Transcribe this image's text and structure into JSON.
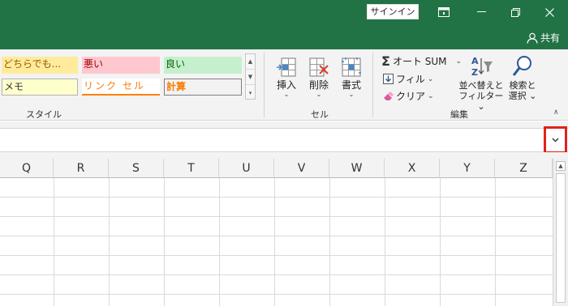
{
  "titlebar": {
    "signin_label": "サインイン",
    "controls": [
      "ribbon-display-options-icon",
      "minimize-icon",
      "restore-icon",
      "close-icon"
    ]
  },
  "tabbar": {
    "share_label": "共有"
  },
  "styles_group": {
    "cells": [
      {
        "label": "どちらでも...",
        "bg": "#ffeb9c",
        "color": "#9c5700"
      },
      {
        "label": "悪い",
        "bg": "#ffc7ce",
        "color": "#9c0006"
      },
      {
        "label": "良い",
        "bg": "#c6efce",
        "color": "#006100"
      },
      {
        "label": "メモ",
        "bg": "#ffffcc",
        "color": "#333333"
      },
      {
        "label": "リンク セル",
        "bg": "#ffffff",
        "color": "#fa7d00"
      },
      {
        "label": "計算",
        "bg": "#f2f2f2",
        "color": "#fa7d00"
      }
    ],
    "group_label": "スタイル"
  },
  "cells_group": {
    "insert_label": "挿入",
    "delete_label": "削除",
    "format_label": "書式",
    "group_label": "セル"
  },
  "editing_group": {
    "autosum_label": "オート SUM",
    "fill_label": "フィル",
    "clear_label": "クリア",
    "sort_label_1": "並べ替えと",
    "sort_label_2": "フィルター",
    "find_label_1": "検索と",
    "find_label_2": "選択",
    "group_label": "編集"
  },
  "formula_bar": {
    "value": "",
    "expand_icon": "chevron-down-icon",
    "highlight_color": "#e0231b"
  },
  "grid": {
    "columns": [
      "Q",
      "R",
      "S",
      "T",
      "U",
      "V",
      "W",
      "X",
      "Y",
      "Z"
    ]
  },
  "colors": {
    "title_bar": "#217346",
    "ribbon": "#f3f3f3",
    "gridline": "#dadada"
  }
}
